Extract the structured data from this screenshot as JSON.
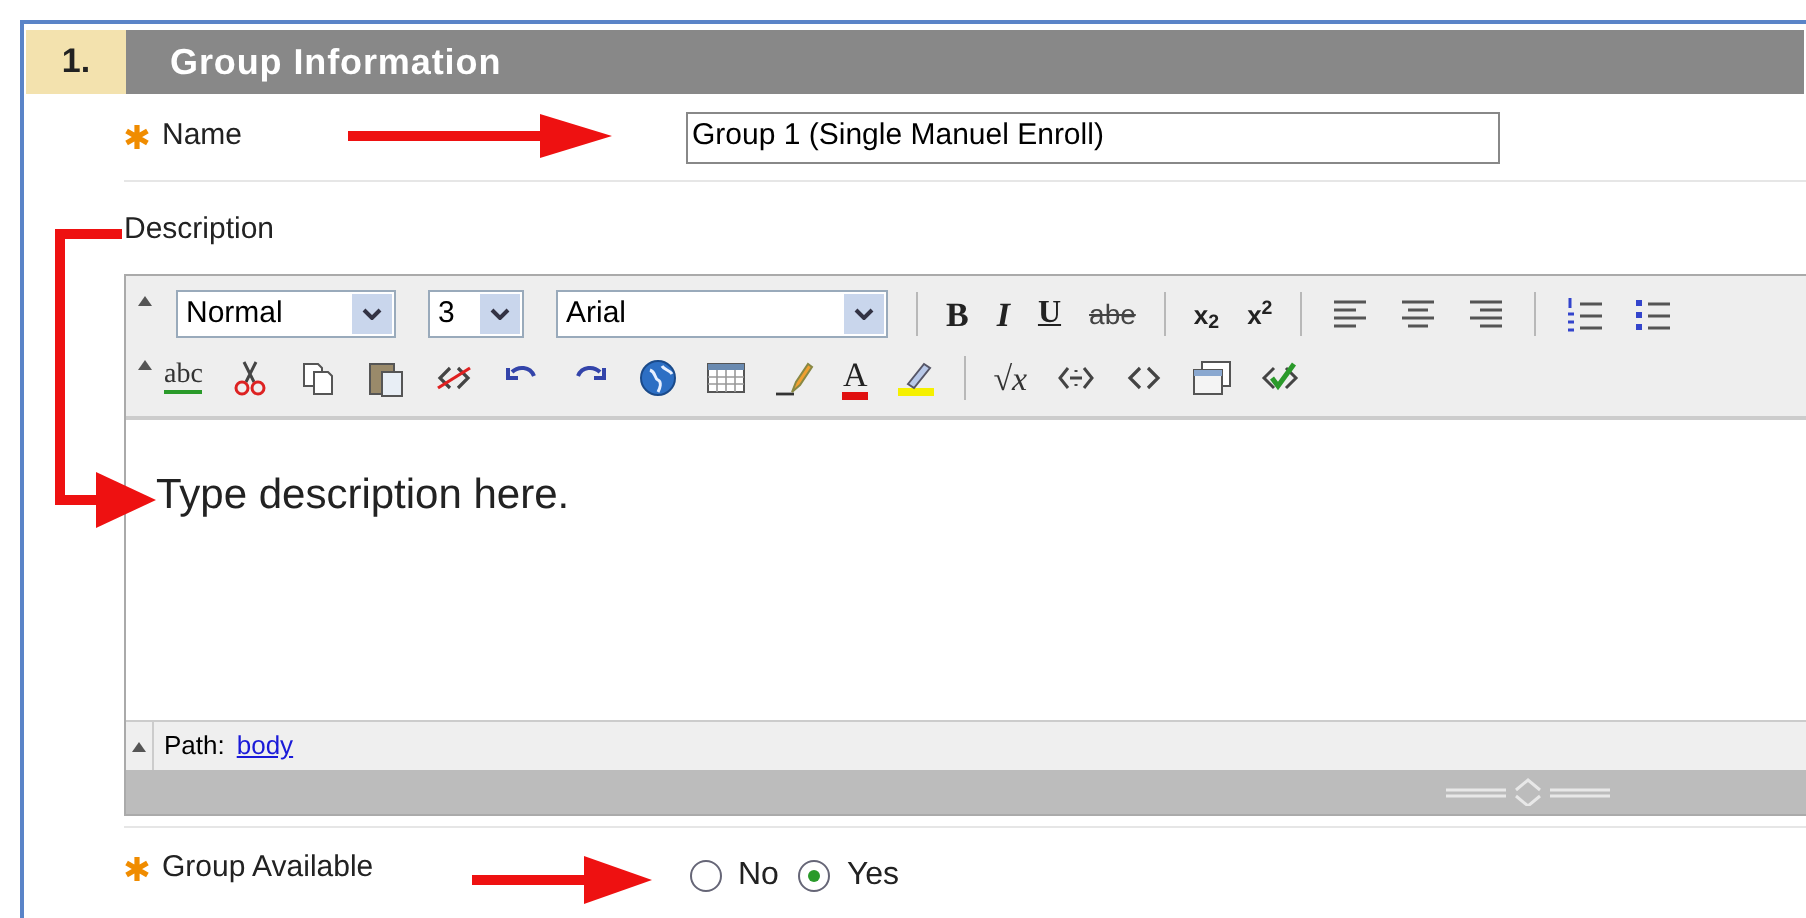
{
  "section": {
    "number": "1.",
    "title": "Group Information"
  },
  "name_field": {
    "label": "Name",
    "required": true,
    "value": "Group 1 (Single Manuel Enroll)"
  },
  "description_field": {
    "label": "Description"
  },
  "editor": {
    "toolbar_rows": [
      [
        {
          "kind": "collapse"
        },
        {
          "kind": "style-select",
          "value": "Normal"
        },
        {
          "kind": "size-select",
          "value": "3"
        },
        {
          "kind": "font-select",
          "value": "Arial"
        },
        {
          "kind": "separator"
        },
        {
          "kind": "bold",
          "glyph": "B"
        },
        {
          "kind": "italic",
          "glyph": "I"
        },
        {
          "kind": "underline",
          "glyph": "U"
        },
        {
          "kind": "strike",
          "glyph": "abe"
        },
        {
          "kind": "separator"
        },
        {
          "kind": "subscript",
          "glyph": "x$_{2}$"
        },
        {
          "kind": "superscript",
          "glyph": "x$^{2}$"
        },
        {
          "kind": "separator"
        },
        {
          "kind": "align-left"
        },
        {
          "kind": "align-center"
        },
        {
          "kind": "align-right"
        },
        {
          "kind": "separator"
        },
        {
          "kind": "ordered-list"
        },
        {
          "kind": "bullet-list"
        }
      ],
      [
        {
          "kind": "collapse"
        },
        {
          "kind": "spellcheck",
          "glyph": "abc"
        },
        {
          "kind": "cut"
        },
        {
          "kind": "copy"
        },
        {
          "kind": "paste"
        },
        {
          "kind": "unlink"
        },
        {
          "kind": "undo"
        },
        {
          "kind": "redo"
        },
        {
          "kind": "globe"
        },
        {
          "kind": "table"
        },
        {
          "kind": "pencil"
        },
        {
          "kind": "font-color",
          "glyph": "A"
        },
        {
          "kind": "highlight"
        },
        {
          "kind": "separator"
        },
        {
          "kind": "math",
          "glyph": "√x"
        },
        {
          "kind": "embed"
        },
        {
          "kind": "html"
        },
        {
          "kind": "window"
        },
        {
          "kind": "validate"
        }
      ]
    ],
    "content": "Type description here.",
    "path_label": "Path:",
    "path_link": "body"
  },
  "availability": {
    "label": "Group Available",
    "required": true,
    "options": [
      {
        "label": "No",
        "selected": false
      },
      {
        "label": "Yes",
        "selected": true
      }
    ]
  }
}
